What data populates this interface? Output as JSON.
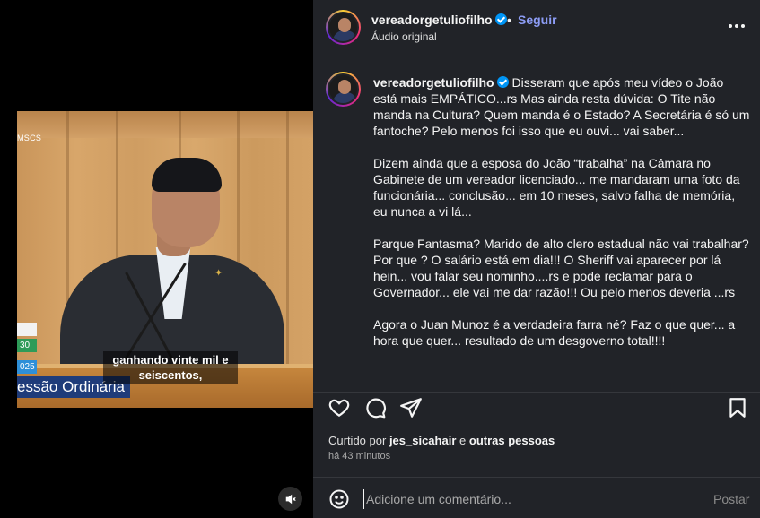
{
  "video": {
    "channel_logo": "MSCS",
    "lower_third_numbers": [
      "30",
      "025"
    ],
    "session_title": "essão Ordinária",
    "subtitle": "ganhando vinte mil e seiscentos,",
    "mute_icon": "speaker-muted-icon"
  },
  "header": {
    "username": "vereadorgetuliofilho",
    "separator": "•",
    "follow_label": "Seguir",
    "audio_label": "Áudio original",
    "more_icon": "more-horizontal-icon"
  },
  "caption": {
    "username": "vereadorgetuliofilho",
    "paragraphs": [
      "Disseram que após meu vídeo o João está mais EMPÁTICO...rs Mas ainda resta dúvida: O Tite não manda na Cultura? Quem manda é o Estado? A Secretária é só um fantoche? Pelo menos foi isso que eu ouvi... vai saber...",
      "Dizem ainda que a esposa do João “trabalha” na Câmara no Gabinete de um vereador licenciado... me mandaram uma foto da funcionária... conclusão... em 10 meses, salvo falha de memória, eu nunca a vi lá...",
      "Parque Fantasma? Marido de alto clero estadual não vai trabalhar? Por que ? O salário está em dia!!! O Sheriff vai aparecer por lá hein... vou falar seu nominho....rs e pode reclamar para o Governador... ele vai me dar razão!!! Ou pelo menos deveria ...rs",
      "Agora o Juan Munoz é a verdadeira farra né? Faz o que quer... a hora que quer... resultado de um desgoverno total!!!!"
    ]
  },
  "actions": {
    "icons": [
      "heart-icon",
      "comment-icon",
      "share-icon",
      "bookmark-icon"
    ]
  },
  "likes": {
    "prefix": "Curtido por",
    "user": "jes_sicahair",
    "connector": "e",
    "others": "outras pessoas"
  },
  "time_ago": "há 43 minutos",
  "comment": {
    "placeholder": "Adicione um comentário...",
    "post_label": "Postar"
  },
  "colors": {
    "panel_bg": "#212328",
    "accent_blue": "#0095f6",
    "follow_text": "#8c9cf5"
  }
}
